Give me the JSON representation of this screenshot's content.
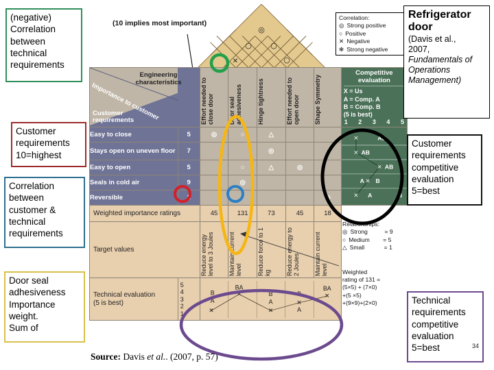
{
  "slide": {
    "source_prefix": "Source:",
    "source_author": "Davis",
    "source_etal": "et al.",
    "source_ref": ". (2007, p. 57)",
    "page_number": "34"
  },
  "callouts": [
    {
      "id": "negative-correlation",
      "text": "(negative)\nCorrelation\nbetween\ntechnical\nrequirements",
      "border_color": "#2f8f5b"
    },
    {
      "id": "customer-requirements",
      "text": "Customer\nrequirements\n10=highest",
      "border_color": "#9e2b2b"
    },
    {
      "id": "correlation-customer-technical",
      "text": "Correlation\nbetween\ncustomer &\ntechnical\nrequirements",
      "border_color": "#2d6f8e"
    },
    {
      "id": "door-seal-importance",
      "text": "Door seal\nadhesiveness\nImportance\nweight.\nSum of",
      "border_color": "#d8c14a"
    },
    {
      "id": "customer-competitive-evaluation",
      "text": "Customer\nrequirements\ncompetitive\nevaluation\n5=best",
      "border_color": "#111111"
    },
    {
      "id": "technical-competitive-evaluation",
      "text": "Technical\nrequirements\ncompetitive\nevaluation\n5=best",
      "border_color": "#6b4a8e"
    }
  ],
  "title_box": {
    "title": "Refrigerator door",
    "citation_line1": "(Davis et al.,",
    "citation_line2": "2007,",
    "citation_line3": "Fundamentals of",
    "citation_line4": "Operations",
    "citation_line5": "Management)"
  },
  "figure": {
    "importance_note": "(10 implies most important)",
    "engineering_characteristics_label": "Engineering\ncharacteristics",
    "importance_to_customer_label": "Importance to customer",
    "customer_requirements_label": "Customer\nrequirements",
    "weighted_importance_label": "Weighted importance ratings",
    "target_values_label": "Target values",
    "technical_evaluation_label": "Technical evaluation\n(5 is best)",
    "technical_scale": [
      "5",
      "4",
      "3",
      "2",
      "1"
    ]
  },
  "correlation_legend": {
    "title": "Correlation:",
    "items": [
      {
        "symbol": "strong-positive-icon",
        "glyph": "◎",
        "label": "Strong positive"
      },
      {
        "symbol": "positive-icon",
        "glyph": "○",
        "label": "Positive"
      },
      {
        "symbol": "negative-icon",
        "glyph": "✕",
        "label": "Negative"
      },
      {
        "symbol": "strong-negative-icon",
        "glyph": "✻",
        "label": "Strong negative"
      }
    ]
  },
  "relationships_legend": {
    "title": "Relationships:",
    "items": [
      {
        "symbol": "strong-icon",
        "glyph": "◎",
        "label": "Strong",
        "value": "= 9"
      },
      {
        "symbol": "medium-icon",
        "glyph": "○",
        "label": "Medium",
        "value": "= 5"
      },
      {
        "symbol": "small-icon",
        "glyph": "△",
        "label": "Small",
        "value": "= 1"
      }
    ]
  },
  "weighted_note": {
    "line1": "Weighted",
    "line2": "rating of 131 =",
    "line3": "(5×5) + (7×0)",
    "line4": "+(5 ×5)",
    "line5": "+(9×9)+(2×0)"
  },
  "competitive_evaluation": {
    "title": "Competitive\nevaluation",
    "key_line1": "X = Us",
    "key_line2": "A = Comp. A",
    "key_line3": "B = Comp. B",
    "key_line4": "(5 is best)",
    "scale": [
      "1",
      "2",
      "3",
      "4",
      "5"
    ]
  },
  "chart_data": {
    "type": "table",
    "title": "House of Quality — Refrigerator door",
    "technical_requirements": [
      "Effort needed to close door",
      "Door seal adhesiveness",
      "Hinge tightness",
      "Effort needed to open door",
      "Shape Symmetry"
    ],
    "customer_requirements": [
      {
        "name": "Easy to close",
        "importance": "5",
        "relationships": [
          "◎",
          "○",
          "△",
          "",
          ""
        ]
      },
      {
        "name": "Stays open on uneven floor",
        "importance": "7",
        "relationships": [
          "",
          "",
          "◎",
          "",
          ""
        ]
      },
      {
        "name": "Easy to open",
        "importance": "5",
        "relationships": [
          "",
          "○",
          "△",
          "◎",
          ""
        ]
      },
      {
        "name": "Seals in cold air",
        "importance": "9",
        "relationships": [
          "",
          "◎",
          "",
          "",
          ""
        ]
      },
      {
        "name": "Reversible",
        "importance": "2",
        "relationships": [
          "",
          "",
          "",
          "",
          "◎"
        ]
      }
    ],
    "weighted_importance_ratings": [
      "45",
      "131",
      "73",
      "45",
      "18"
    ],
    "target_values": [
      "Reduce energy level to 3 Joules",
      "Maintain current level",
      "Reduce force to 1 kg",
      "Reduce energy to 2 Joules",
      "Maintain current level"
    ],
    "technical_evaluation": [
      {
        "column": "Effort needed to close door",
        "X": 2,
        "A": 4,
        "B": 4
      },
      {
        "column": "Door seal adhesiveness",
        "X": 4,
        "A": 4,
        "B": 4
      },
      {
        "column": "Hinge tightness",
        "X": 2,
        "A": 3,
        "B": 3
      },
      {
        "column": "Effort needed to open door",
        "X": 3,
        "A": 2,
        "B": 3
      },
      {
        "column": "Shape Symmetry",
        "X": 4,
        "A": 4,
        "B": 4
      }
    ],
    "customer_competitive_evaluation": [
      {
        "requirement": "Easy to close",
        "X": 2,
        "AB": 4
      },
      {
        "requirement": "Stays open on uneven floor",
        "X": 1,
        "AB": 2
      },
      {
        "requirement": "Easy to open",
        "X": 3,
        "AB": 4
      },
      {
        "requirement": "Seals in cold air",
        "X": 3,
        "A": 2,
        "B": 4
      },
      {
        "requirement": "Reversible",
        "X": 2,
        "A": 3,
        "B": 5
      }
    ],
    "roof_correlations": [
      {
        "pair": [
          "Effort needed to close door",
          "Door seal adhesiveness"
        ],
        "symbol": "✕"
      },
      {
        "pair": [
          "Effort needed to close door",
          "Hinge tightness"
        ],
        "symbol": "○"
      },
      {
        "pair": [
          "Door seal adhesiveness",
          "Effort needed to open door"
        ],
        "symbol": "◎"
      },
      {
        "pair": [
          "Hinge tightness",
          "Effort needed to open door"
        ],
        "symbol": "○"
      },
      {
        "pair": [
          "Hinge tightness",
          "Shape Symmetry"
        ],
        "symbol": "○"
      }
    ]
  }
}
